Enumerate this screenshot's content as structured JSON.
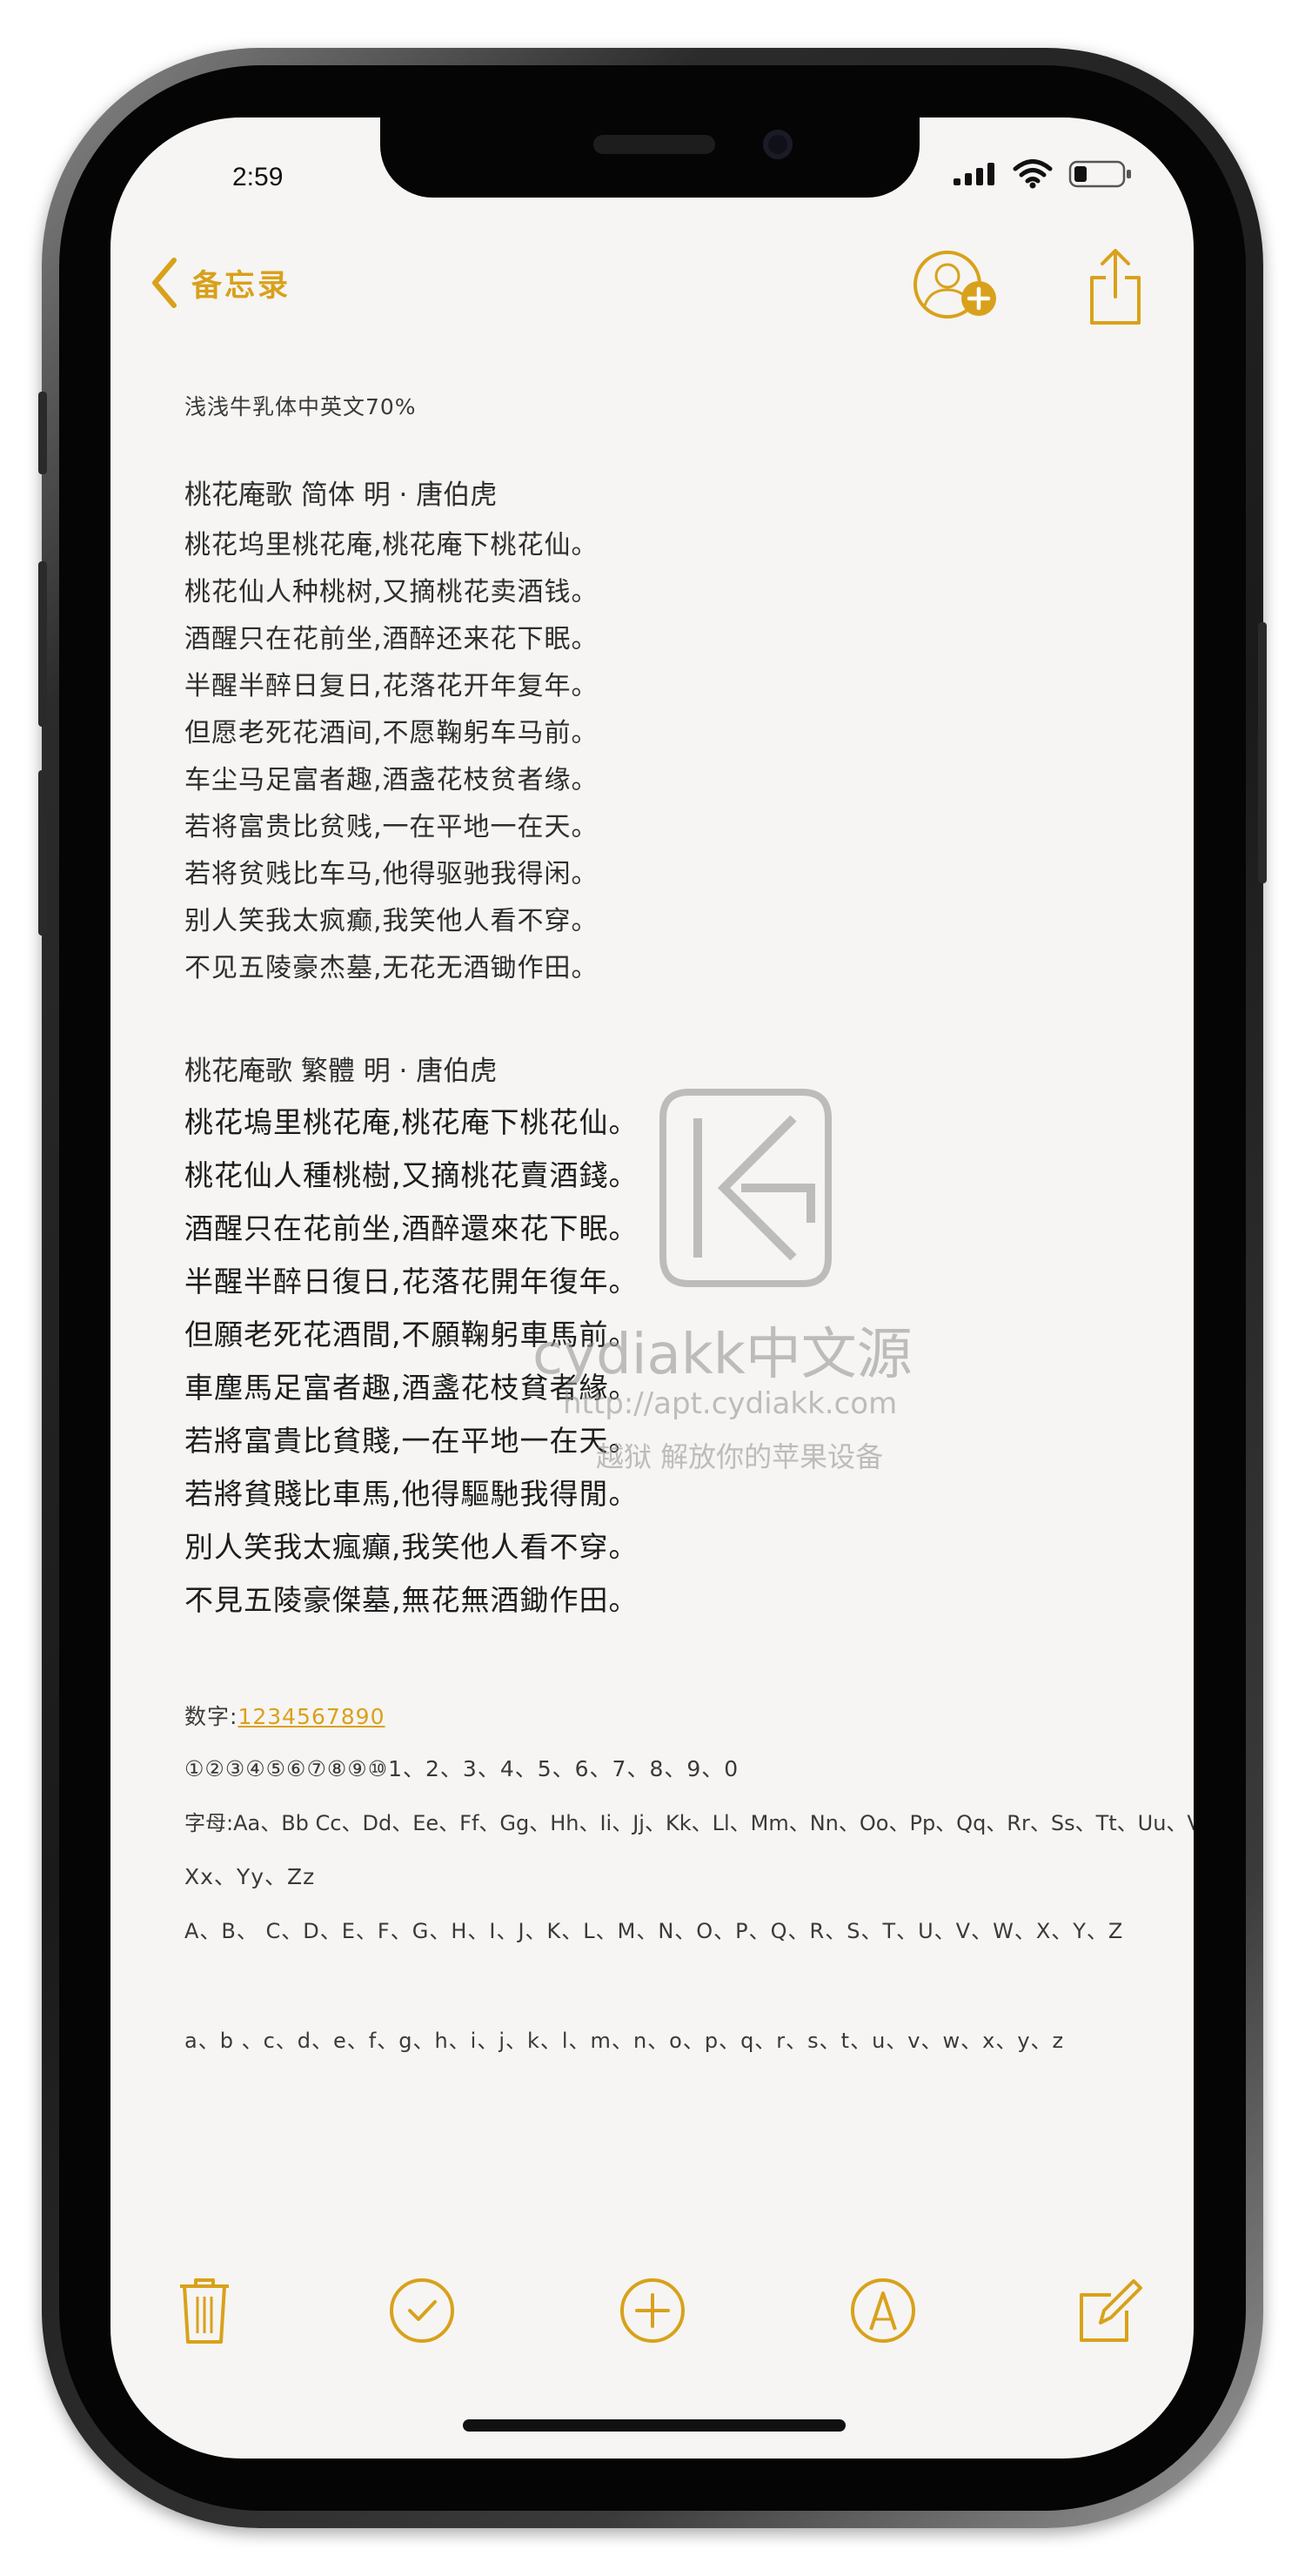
{
  "status": {
    "time": "2:59"
  },
  "nav": {
    "back_label": "备忘录"
  },
  "colors": {
    "accent": "#d9a11b",
    "text": "#2e2e2e",
    "paper": "#f6f5f3"
  },
  "note": {
    "header": "浅浅牛乳体中英文70%",
    "simplified": {
      "title": "桃花庵歌   简体    明 · 唐伯虎",
      "lines": [
        "桃花坞里桃花庵,桃花庵下桃花仙。",
        "桃花仙人种桃树,又摘桃花卖酒钱。",
        "酒醒只在花前坐,酒醉还来花下眠。",
        "半醒半醉日复日,花落花开年复年。",
        "但愿老死花酒间,不愿鞠躬车马前。",
        "车尘马足富者趣,酒盏花枝贫者缘。",
        "若将富贵比贫贱,一在平地一在天。",
        "若将贫贱比车马,他得驱驰我得闲。",
        "别人笑我太疯癫,我笑他人看不穿。",
        "不见五陵豪杰墓,无花无酒锄作田。"
      ]
    },
    "traditional": {
      "title": "桃花庵歌   繁體        明 · 唐伯虎",
      "lines": [
        "桃花塢里桃花庵,桃花庵下桃花仙。",
        "桃花仙人種桃樹,又摘桃花賣酒錢。",
        "酒醒只在花前坐,酒醉還來花下眠。",
        "半醒半醉日復日,花落花開年復年。",
        "但願老死花酒間,不願鞠躬車馬前。",
        "車塵馬足富者趣,酒盞花枝貧者緣。",
        "若將富貴比貧賤,一在平地一在天。",
        "若將貧賤比車馬,他得驅馳我得閒。",
        "別人笑我太瘋癲,我笑他人看不穿。",
        "不見五陵豪傑墓,無花無酒鋤作田。"
      ]
    },
    "digits_label": "数字:",
    "digits_value": "1234567890",
    "circled": "①②③④⑤⑥⑦⑧⑨⑩1、2、3、4、5、6、7、8、9、0",
    "letters_line1": "字母:Aa、Bb Cc、Dd、Ee、Ff、Gg、Hh、Ii、Jj、Kk、Ll、Mm、Nn、Oo、Pp、Qq、Rr、Ss、Tt、Uu、Vv、Ww、",
    "letters_line2": "Xx、Yy、Zz",
    "uppercase": "A、B、 C、D、E、F、G、H、I、J、K、L、M、N、O、P、Q、R、S、T、U、V、W、X、Y、Z",
    "lowercase": "a、b 、c、d、e、f、g、h、i、j、k、l、m、n、o、p、q、r、s、t、u、v、w、x、y、z"
  },
  "watermark": {
    "brand": "cydiakk中文源",
    "url": "http://apt.cydiakk.com",
    "slogan": "越狱 解放你的苹果设备"
  },
  "icons": {
    "back": "chevron-left-icon",
    "add_person": "add-person-icon",
    "share": "share-icon",
    "trash": "trash-icon",
    "checklist": "checkmark-circle-icon",
    "add": "plus-circle-icon",
    "markup": "pen-circle-icon",
    "compose": "compose-icon"
  }
}
